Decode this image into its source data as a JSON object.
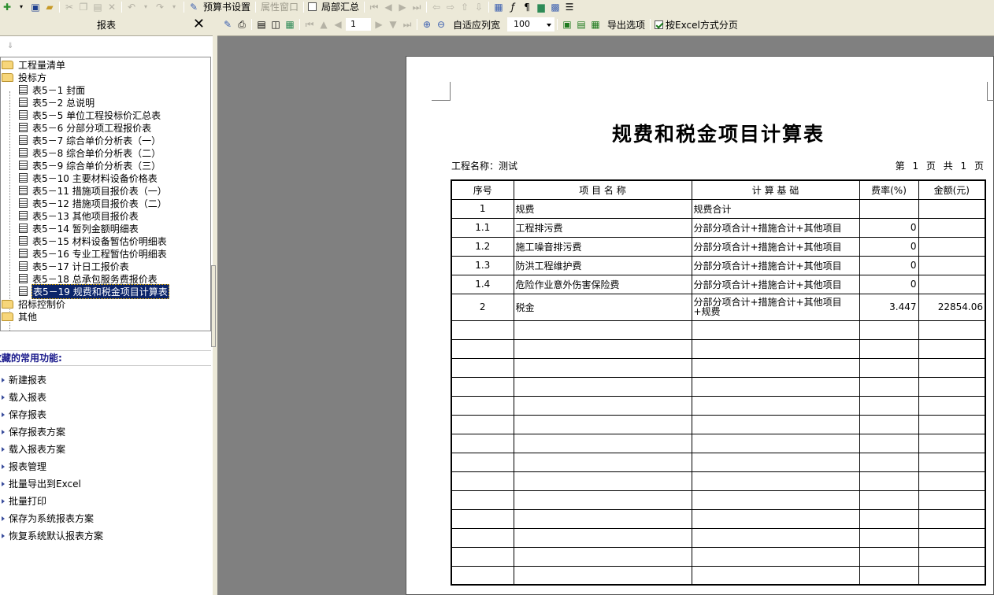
{
  "toolbar": {
    "budget_settings": "预算书设置",
    "property_window": "属性窗口",
    "partial_summary": "局部汇总"
  },
  "panel": {
    "title": "报表",
    "close": "✕",
    "arrow": "⇓"
  },
  "tree": {
    "nodes": [
      {
        "label": "工程量清单",
        "type": "folder"
      },
      {
        "label": "投标方",
        "type": "folder"
      },
      {
        "label": "表5－1 封面",
        "type": "doc"
      },
      {
        "label": "表5－2 总说明",
        "type": "doc"
      },
      {
        "label": "表5－5 单位工程投标价汇总表",
        "type": "doc"
      },
      {
        "label": "表5－6 分部分项工程报价表",
        "type": "doc"
      },
      {
        "label": "表5－7 综合单价分析表（一）",
        "type": "doc"
      },
      {
        "label": "表5－8 综合单价分析表（二）",
        "type": "doc"
      },
      {
        "label": "表5－9 综合单价分析表（三）",
        "type": "doc"
      },
      {
        "label": "表5－10 主要材料设备价格表",
        "type": "doc"
      },
      {
        "label": "表5－11 措施项目报价表（一）",
        "type": "doc"
      },
      {
        "label": "表5－12 措施项目报价表（二）",
        "type": "doc"
      },
      {
        "label": "表5－13 其他项目报价表",
        "type": "doc"
      },
      {
        "label": "表5－14 暂列金额明细表",
        "type": "doc"
      },
      {
        "label": "表5－15 材料设备暂估价明细表",
        "type": "doc"
      },
      {
        "label": "表5－16 专业工程暂估价明细表",
        "type": "doc"
      },
      {
        "label": "表5－17 计日工报价表",
        "type": "doc"
      },
      {
        "label": "表5－18 总承包服务费报价表",
        "type": "doc"
      },
      {
        "label": "表5－19 规费和税金项目计算表",
        "type": "doc",
        "selected": true
      },
      {
        "label": "招标控制价",
        "type": "folder"
      },
      {
        "label": "其他",
        "type": "folder"
      }
    ]
  },
  "functions": {
    "title": "收藏的常用功能:",
    "items": [
      "新建报表",
      "载入报表",
      "保存报表",
      "保存报表方案",
      "载入报表方案",
      "报表管理",
      "批量导出到Excel",
      "批量打印",
      "保存为系统报表方案",
      "恢复系统默认报表方案"
    ]
  },
  "viewer": {
    "page_number": "1",
    "fit_width": "自适应列宽",
    "zoom": "100",
    "export_options": "导出选项",
    "excel_paging": "按Excel方式分页"
  },
  "report": {
    "title": "规费和税金项目计算表",
    "project_label": "工程名称：测试",
    "page_info": "第 1 页 共 1 页",
    "headers": [
      "序号",
      "项 目 名 称",
      "计 算 基 础",
      "费率(%)",
      "金额(元)"
    ],
    "rows": [
      {
        "no": "1",
        "name": "规费",
        "basis": "规费合计",
        "rate": "",
        "amount": ""
      },
      {
        "no": "1.1",
        "name": "工程排污费",
        "basis": "分部分项合计+措施合计+其他项目",
        "rate": "0",
        "amount": ""
      },
      {
        "no": "1.2",
        "name": "施工噪音排污费",
        "basis": "分部分项合计+措施合计+其他项目",
        "rate": "0",
        "amount": ""
      },
      {
        "no": "1.3",
        "name": "防洪工程维护费",
        "basis": "分部分项合计+措施合计+其他项目",
        "rate": "0",
        "amount": ""
      },
      {
        "no": "1.4",
        "name": "危险作业意外伤害保险费",
        "basis": "分部分项合计+措施合计+其他项目",
        "rate": "0",
        "amount": ""
      },
      {
        "no": "2",
        "name": "税金",
        "basis": "分部分项合计+措施合计+其他项目+规费",
        "rate": "3.447",
        "amount": "22854.06"
      }
    ]
  }
}
